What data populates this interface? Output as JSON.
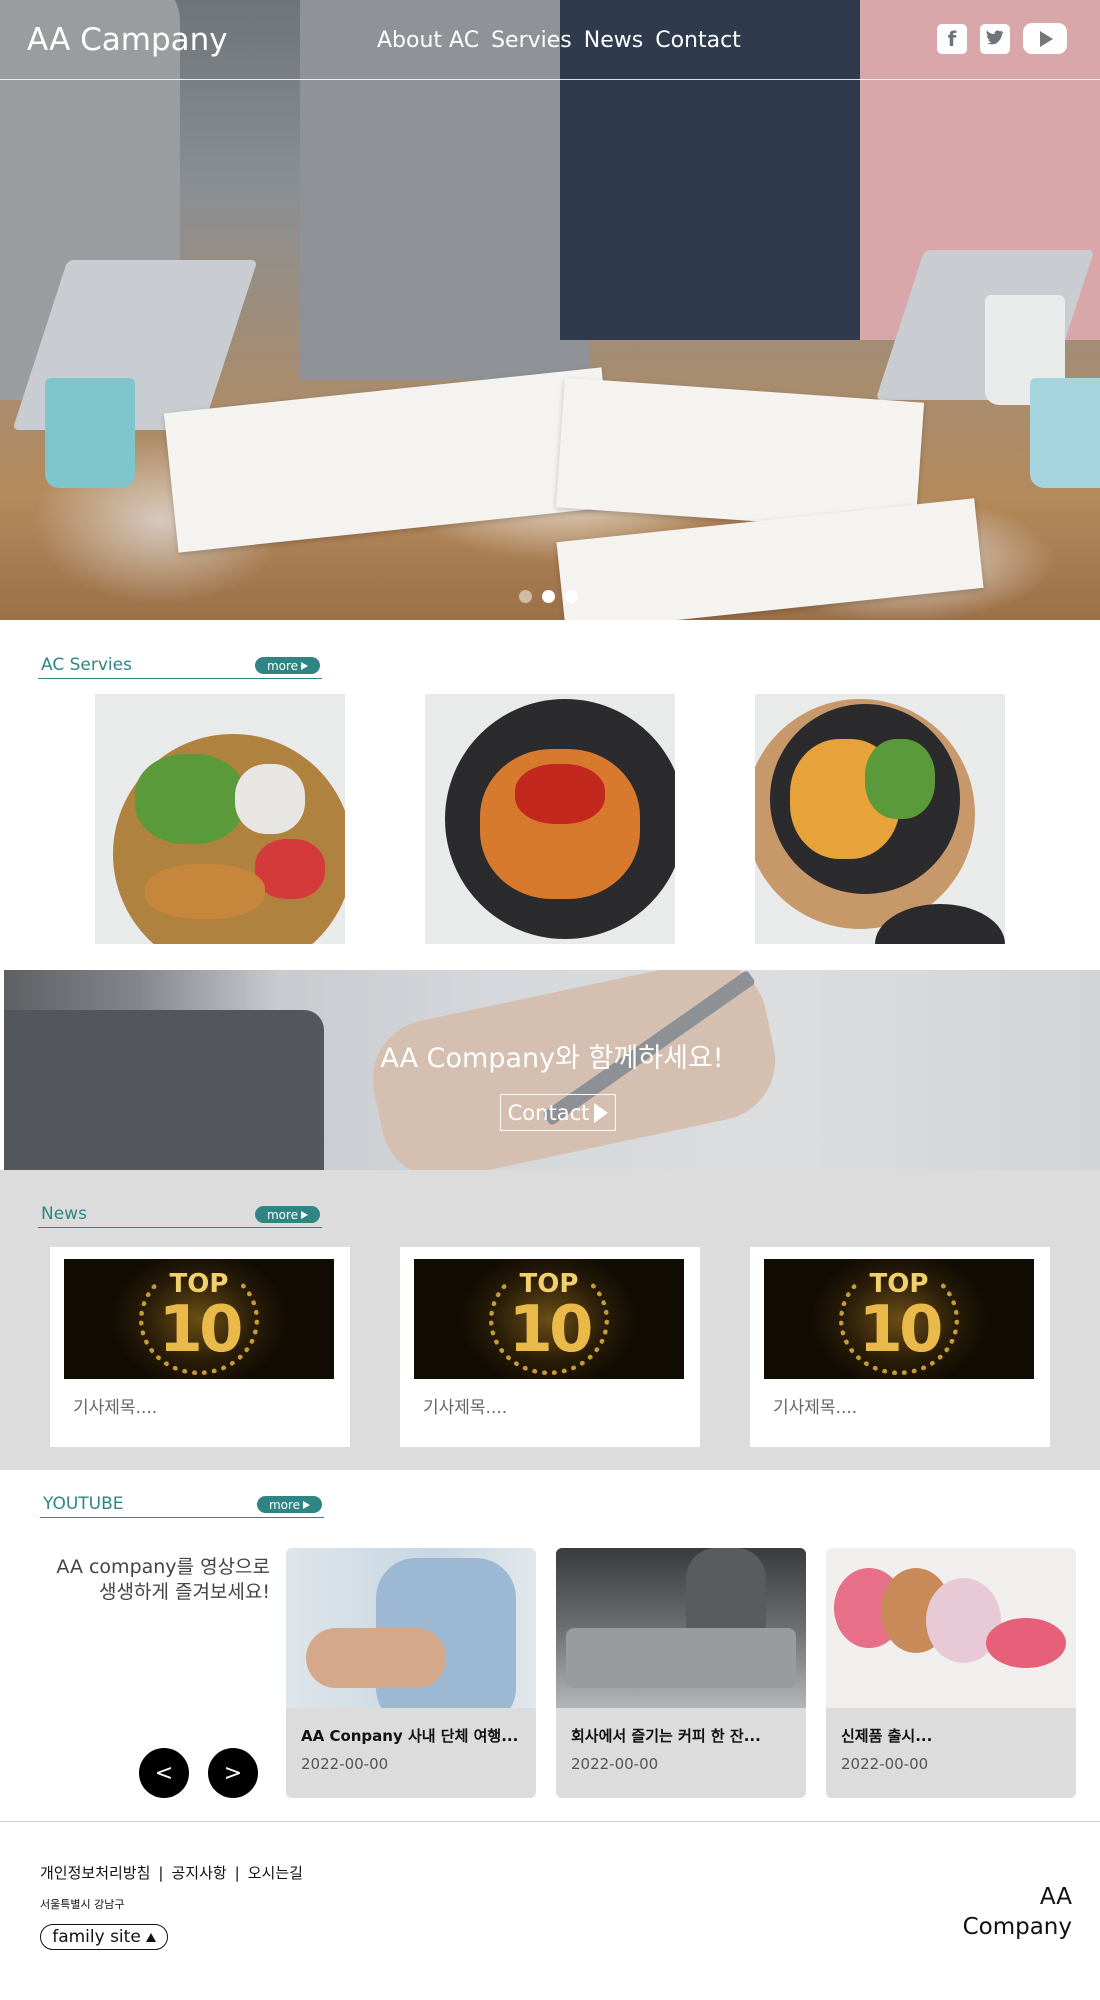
{
  "header": {
    "logo": "AA Campany",
    "nav": [
      "About AC",
      "Servies",
      "News",
      "Contact"
    ],
    "social_icons": [
      "facebook-icon",
      "twitter-icon",
      "youtube-icon"
    ]
  },
  "hero": {
    "slide_count": 3,
    "active_slide": 2
  },
  "services": {
    "title": "AC Servies",
    "more_label": "more"
  },
  "banner": {
    "title": "AA Company와 함께하세요!",
    "button_label": "Contact"
  },
  "news": {
    "title": "News",
    "more_label": "more",
    "cards": [
      {
        "badge_top": "TOP",
        "badge_num": "10",
        "caption": "기사제목...."
      },
      {
        "badge_top": "TOP",
        "badge_num": "10",
        "caption": "기사제목...."
      },
      {
        "badge_top": "TOP",
        "badge_num": "10",
        "caption": "기사제목...."
      }
    ]
  },
  "youtube": {
    "title": "YOUTUBE",
    "more_label": "more",
    "intro_line1": "AA company를 영상으로",
    "intro_line2": "생생하게 즐겨보세요!",
    "prev_label": "<",
    "next_label": ">",
    "videos": [
      {
        "title": "AA Conpany 사내 단체 여행...",
        "date": "2022-00-00"
      },
      {
        "title": "회사에서 즐기는 커피 한 잔...",
        "date": "2022-00-00"
      },
      {
        "title": "신제품 출시...",
        "date": "2022-00-00"
      }
    ]
  },
  "footer": {
    "links": [
      "개인정보처리방침",
      "공지사항",
      "오시는길"
    ],
    "separator": "|",
    "address": "서울특별시 강남구",
    "family_site": "family site",
    "logo_line1": "AA",
    "logo_line2": "Company"
  },
  "colors": {
    "accent": "#2f8484",
    "news_bg": "#dcdcdc",
    "video_card_bg": "#dcdcdc"
  }
}
